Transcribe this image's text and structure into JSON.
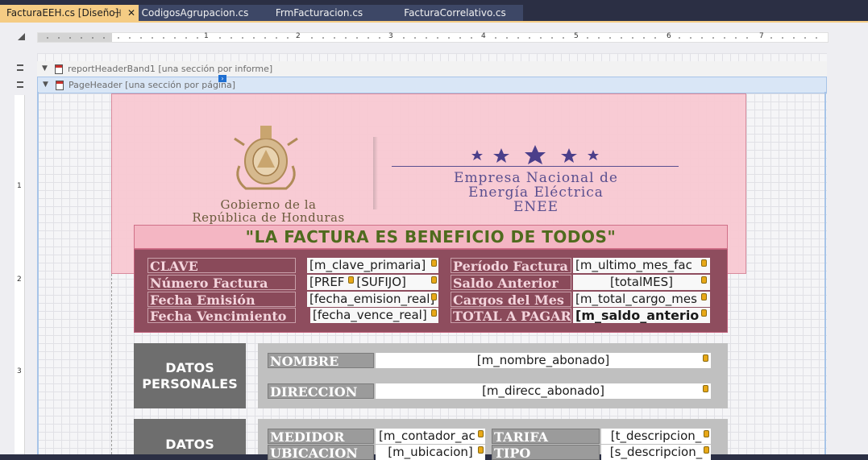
{
  "tabs": [
    {
      "label": "FacturaEEH.cs [Diseño]",
      "active": true
    },
    {
      "label": "CodigosAgrupacion.cs",
      "active": false
    },
    {
      "label": "FrmFacturacion.cs",
      "active": false
    },
    {
      "label": "FacturaCorrelativo.cs",
      "active": false
    }
  ],
  "tab_icons": {
    "pin": "⊣",
    "close": "✕"
  },
  "ruler_numbers": [
    "1",
    "2",
    "3",
    "4",
    "5",
    "6",
    "7"
  ],
  "ruler_v_numbers": [
    "1",
    "2",
    "3"
  ],
  "bands": {
    "report_header": "reportHeaderBand1 [una sección por informe]",
    "page_header": "PageHeader [una sección por página]"
  },
  "logo_gov": {
    "line1": "Gobierno de la",
    "line2": "República de Honduras"
  },
  "logo_enee": {
    "line1": "Empresa Nacional de",
    "line2": "Energía Eléctrica",
    "line3": "ENEE"
  },
  "slogan": "\"LA FACTURA ES BENEFICIO DE TODOS\"",
  "info_fields": [
    {
      "label": "CLAVE",
      "value": "[m_clave_primaria]"
    },
    {
      "label": "Número Factura",
      "value": "[PREF - [SUFIJO]"
    },
    {
      "label": "Fecha Emisión",
      "value": "[fecha_emision_real]"
    },
    {
      "label": "Fecha Vencimiento",
      "value": "[fecha_vence_real]"
    }
  ],
  "info_fields_right": [
    {
      "label": "Período Factura",
      "value": "[m_ultimo_mes_fac"
    },
    {
      "label": "Saldo Anterior",
      "value": "[totalMES]"
    },
    {
      "label": "Cargos del Mes",
      "value": "[m_total_cargo_mes"
    },
    {
      "label": "TOTAL A PAGAR",
      "value": "[m_saldo_anterio"
    }
  ],
  "datos_personales": {
    "title_line1": "DATOS",
    "title_line2": "PERSONALES",
    "nombre_label": "NOMBRE",
    "nombre_value": "[m_nombre_abonado]",
    "direccion_label": "DIRECCION",
    "direccion_value": "[m_direcc_abonado]"
  },
  "datos_2": {
    "title_line1": "DATOS",
    "medidor_label": "MEDIDOR",
    "medidor_value": "[m_contador_ac",
    "tarifa_label": "TARIFA",
    "tarifa_value": "[t_descripcion_",
    "ubicacion_label": "UBICACION",
    "ubicacion_value": "[m_ubicacion]",
    "tipo_label": "TIPO",
    "tipo_value": "[s_descripcion_"
  },
  "colors": {
    "active_tab": "#f5cc84",
    "header_pink": "#f8c8d2",
    "info_maroon": "#8e4d5e",
    "slogan_green": "#4f6b1e",
    "section_gray": "#c0c0c0",
    "section_head": "#6e6e6e"
  }
}
